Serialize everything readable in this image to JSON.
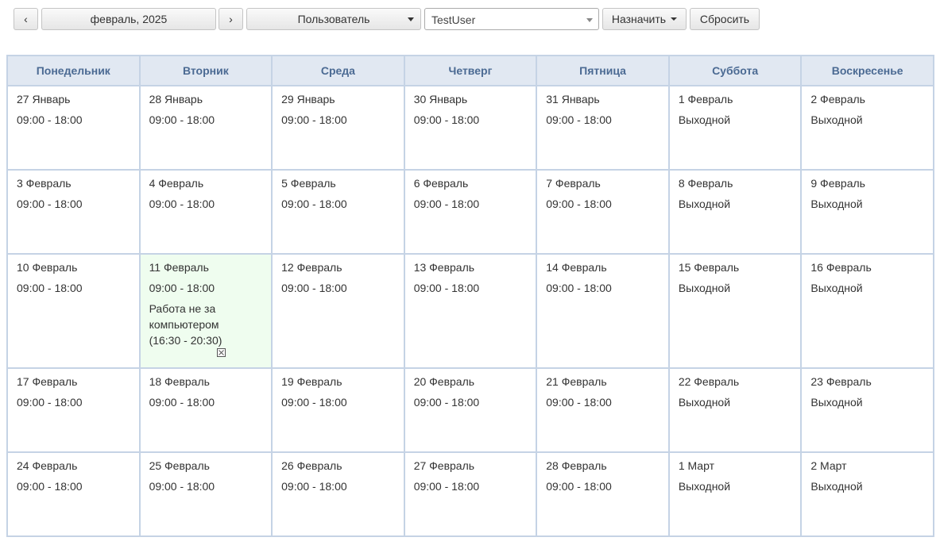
{
  "toolbar": {
    "prev_label": "‹",
    "month_label": "февраль, 2025",
    "next_label": "›",
    "mode_select": "Пользователь",
    "user_select": "TestUser",
    "assign_label": "Назначить",
    "reset_label": "Сбросить"
  },
  "calendar": {
    "weekdays": [
      "Понедельник",
      "Вторник",
      "Среда",
      "Четверг",
      "Пятница",
      "Суббота",
      "Воскресенье"
    ],
    "weeks": [
      [
        {
          "date": "27 Январь",
          "schedule": "09:00 - 18:00"
        },
        {
          "date": "28 Январь",
          "schedule": "09:00 - 18:00"
        },
        {
          "date": "29 Январь",
          "schedule": "09:00 - 18:00"
        },
        {
          "date": "30 Январь",
          "schedule": "09:00 - 18:00"
        },
        {
          "date": "31 Январь",
          "schedule": "09:00 - 18:00"
        },
        {
          "date": "1 Февраль",
          "schedule": "Выходной"
        },
        {
          "date": "2 Февраль",
          "schedule": "Выходной"
        }
      ],
      [
        {
          "date": "3 Февраль",
          "schedule": "09:00 - 18:00"
        },
        {
          "date": "4 Февраль",
          "schedule": "09:00 - 18:00"
        },
        {
          "date": "5 Февраль",
          "schedule": "09:00 - 18:00"
        },
        {
          "date": "6 Февраль",
          "schedule": "09:00 - 18:00"
        },
        {
          "date": "7 Февраль",
          "schedule": "09:00 - 18:00"
        },
        {
          "date": "8 Февраль",
          "schedule": "Выходной"
        },
        {
          "date": "9 Февраль",
          "schedule": "Выходной"
        }
      ],
      [
        {
          "date": "10 Февраль",
          "schedule": "09:00 - 18:00"
        },
        {
          "date": "11 Февраль",
          "schedule": "09:00 - 18:00",
          "today": true,
          "event": "Работа не за компьютером (16:30 - 20:30)",
          "event_icon": "delete-icon"
        },
        {
          "date": "12 Февраль",
          "schedule": "09:00 - 18:00"
        },
        {
          "date": "13 Февраль",
          "schedule": "09:00 - 18:00"
        },
        {
          "date": "14 Февраль",
          "schedule": "09:00 - 18:00"
        },
        {
          "date": "15 Февраль",
          "schedule": "Выходной"
        },
        {
          "date": "16 Февраль",
          "schedule": "Выходной"
        }
      ],
      [
        {
          "date": "17 Февраль",
          "schedule": "09:00 - 18:00"
        },
        {
          "date": "18 Февраль",
          "schedule": "09:00 - 18:00"
        },
        {
          "date": "19 Февраль",
          "schedule": "09:00 - 18:00"
        },
        {
          "date": "20 Февраль",
          "schedule": "09:00 - 18:00"
        },
        {
          "date": "21 Февраль",
          "schedule": "09:00 - 18:00"
        },
        {
          "date": "22 Февраль",
          "schedule": "Выходной"
        },
        {
          "date": "23 Февраль",
          "schedule": "Выходной"
        }
      ],
      [
        {
          "date": "24 Февраль",
          "schedule": "09:00 - 18:00"
        },
        {
          "date": "25 Февраль",
          "schedule": "09:00 - 18:00"
        },
        {
          "date": "26 Февраль",
          "schedule": "09:00 - 18:00"
        },
        {
          "date": "27 Февраль",
          "schedule": "09:00 - 18:00"
        },
        {
          "date": "28 Февраль",
          "schedule": "09:00 - 18:00"
        },
        {
          "date": "1 Март",
          "schedule": "Выходной"
        },
        {
          "date": "2 Март",
          "schedule": "Выходной"
        }
      ]
    ]
  },
  "colors": {
    "header_bg": "#e1e8f2",
    "header_text": "#4b6a93",
    "border": "#c5d3e5",
    "today_bg": "#effdef"
  }
}
